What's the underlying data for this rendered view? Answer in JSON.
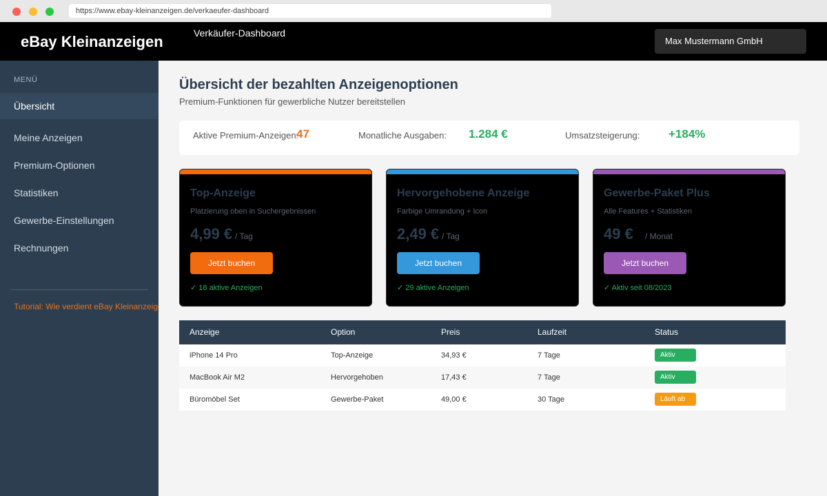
{
  "browser": {
    "url": "https://www.ebay-kleinanzeigen.de/verkaeufer-dashboard"
  },
  "header": {
    "brand": "eBay Kleinanzeigen",
    "page_label": "Verkäufer-Dashboard",
    "account": "Max Mustermann GmbH"
  },
  "sidebar": {
    "heading": "MENÜ",
    "items": [
      {
        "label": "Übersicht",
        "active": true
      },
      {
        "label": "Meine Anzeigen"
      },
      {
        "label": "Premium-Optionen"
      },
      {
        "label": "Statistiken"
      },
      {
        "label": "Gewerbe-Einstellungen"
      },
      {
        "label": "Rechnungen"
      }
    ],
    "tutorial": "Tutorial: Wie verdient eBay Kleinanzeigen Geld?"
  },
  "main": {
    "title": "Übersicht der bezahlten Anzeigenoptionen",
    "subtitle": "Premium-Funktionen für gewerbliche Nutzer bereitstellen",
    "stats": [
      {
        "label": "Aktive Premium-Anzeigen:",
        "value": "47",
        "color": "#e8731a"
      },
      {
        "label": "Monatliche Ausgaben:",
        "value": "1.284 €",
        "color": "#27ae60"
      },
      {
        "label": "Umsatzsteigerung:",
        "value": "+184%",
        "color": "#27ae60"
      }
    ],
    "cards": [
      {
        "title": "Top-Anzeige",
        "description": "Platzierung oben in Suchergebnissen",
        "price": "4,99 €",
        "unit": "/ Tag",
        "button": "Jetzt buchen",
        "status": "✓ 18 aktive Anzeigen",
        "accent": "#f26b0f"
      },
      {
        "title": "Hervorgehobene Anzeige",
        "description": "Farbige Umrandung + Icon",
        "price": "2,49 €",
        "unit": "/ Tag",
        "button": "Jetzt buchen",
        "status": "✓ 29 aktive Anzeigen",
        "accent": "#3498db"
      },
      {
        "title": "Gewerbe-Paket Plus",
        "description": "Alle Features + Statistiken",
        "price": "49 €",
        "unit": "/ Monat",
        "button": "Jetzt buchen",
        "status": "✓ Aktiv seit 08/2023",
        "accent": "#9b59b6"
      }
    ],
    "table": {
      "headers": [
        "Anzeige",
        "Option",
        "Preis",
        "Laufzeit",
        "Status"
      ],
      "rows": [
        {
          "anzeige": "iPhone 14 Pro",
          "option": "Top-Anzeige",
          "preis": "34,93 €",
          "laufzeit": "7 Tage",
          "status": "Aktiv",
          "status_color": "#27ae60"
        },
        {
          "anzeige": "MacBook Air M2",
          "option": "Hervorgehoben",
          "preis": "17,43 €",
          "laufzeit": "7 Tage",
          "status": "Aktiv",
          "status_color": "#27ae60"
        },
        {
          "anzeige": "Büromöbel Set",
          "option": "Gewerbe-Paket",
          "preis": "49,00 €",
          "laufzeit": "30 Tage",
          "status": "Läuft ab",
          "status_color": "#f39c12"
        }
      ]
    }
  }
}
